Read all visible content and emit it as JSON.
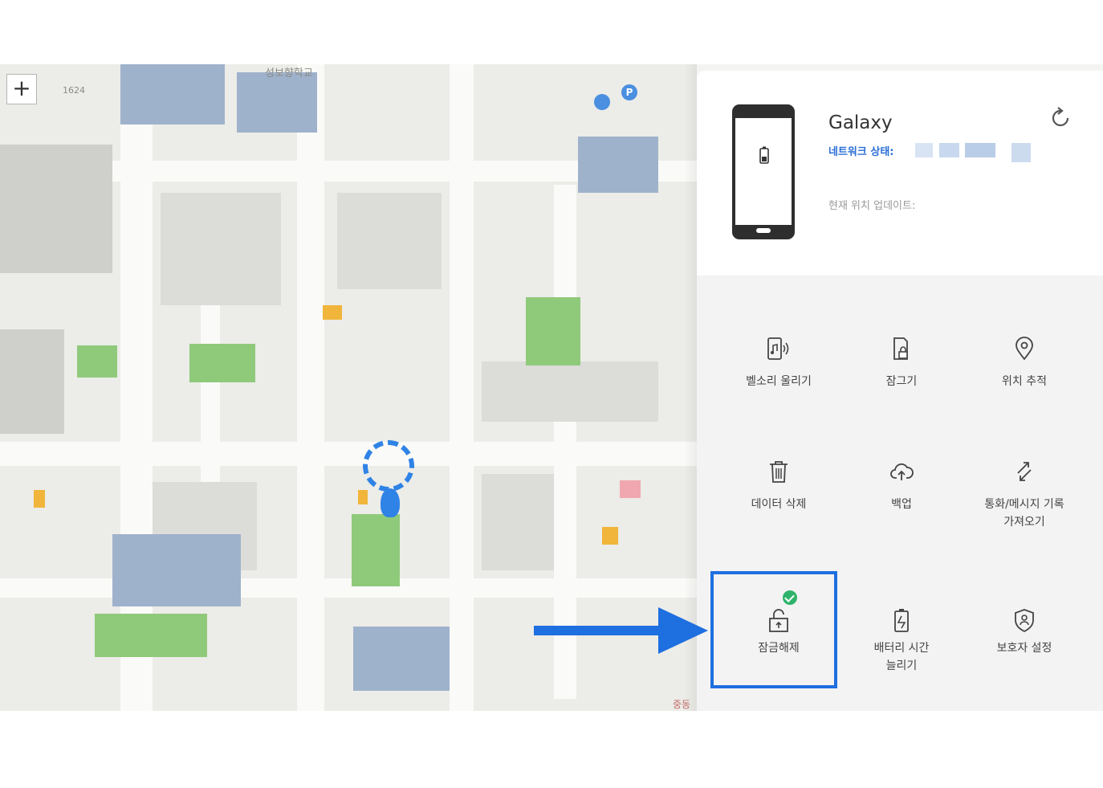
{
  "map": {
    "zoom_in_label": "+",
    "labels": [
      "성보향학교",
      "1624",
      "중동"
    ],
    "parking_label": "P"
  },
  "device": {
    "name": "Galaxy",
    "network_label": "네트워크 상태:",
    "location_update_label": "현재 위치 업데이트:"
  },
  "actions": [
    {
      "id": "ring",
      "label": "벨소리 울리기",
      "icon": "ringtone-icon"
    },
    {
      "id": "lock",
      "label": "잠그기",
      "icon": "lock-device-icon"
    },
    {
      "id": "track",
      "label": "위치 추적",
      "icon": "location-pin-icon"
    },
    {
      "id": "erase",
      "label": "데이터 삭제",
      "icon": "trash-icon"
    },
    {
      "id": "backup",
      "label": "백업",
      "icon": "cloud-upload-icon"
    },
    {
      "id": "retrieve",
      "label": "통화/메시지 기록\n가져오기",
      "icon": "call-arrows-icon"
    },
    {
      "id": "unlock",
      "label": "잠금해제",
      "icon": "unlock-icon"
    },
    {
      "id": "battery",
      "label": "배터리 시간\n늘리기",
      "icon": "battery-icon"
    },
    {
      "id": "guardian",
      "label": "보호자 설정",
      "icon": "shield-person-icon"
    }
  ],
  "colors": {
    "highlight": "#1e6fe0",
    "network_text": "#2b6fd6",
    "check": "#2fb36a"
  }
}
